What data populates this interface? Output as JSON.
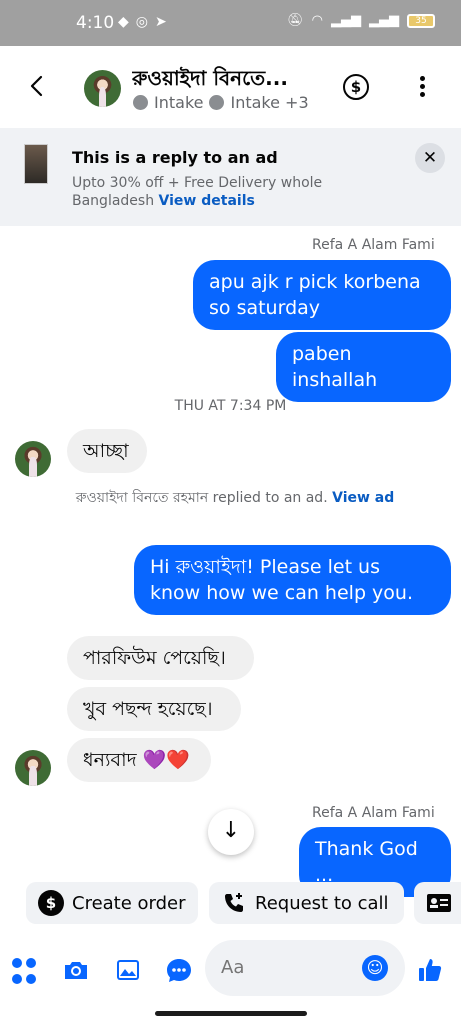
{
  "status_bar": {
    "time": "4:10",
    "battery": "35"
  },
  "header": {
    "title": "রুওয়াইদা বিনতে...",
    "subtitle_items": [
      "Intake",
      "Intake +3"
    ]
  },
  "ad_banner": {
    "title": "This is a reply to an ad",
    "body": "Upto 30% off + Free Delivery whole Bangladesh",
    "link": "View details",
    "close_glyph": "✕"
  },
  "messages": [
    {
      "type": "sender",
      "text": "Refa A Alam Fami"
    },
    {
      "type": "out",
      "text": "apu ajk r pick korbena so saturday"
    },
    {
      "type": "out",
      "text": "paben inshallah"
    },
    {
      "type": "timestamp",
      "text": "THU AT 7:34 PM"
    },
    {
      "type": "in",
      "text": "আচ্ছা"
    },
    {
      "type": "system",
      "text": "রুওয়াইদা বিনতে রহমান replied to an ad.",
      "link": "View ad"
    },
    {
      "type": "out",
      "text": "Hi রুওয়াইদা! Please let us know how we can help you."
    },
    {
      "type": "in",
      "text": "পারফিউম পেয়েছি।"
    },
    {
      "type": "in",
      "text": "খুব পছন্দ হয়েছে।"
    },
    {
      "type": "in",
      "text": "ধন্যবাদ 💜❤️"
    },
    {
      "type": "sender",
      "text": "Refa A Alam Fami"
    },
    {
      "type": "out",
      "text": "Thank God ..."
    }
  ],
  "quick_actions": {
    "create_order": "Create order",
    "request_call": "Request to call"
  },
  "composer": {
    "placeholder": "Aa"
  },
  "colors": {
    "accent": "#0866ff",
    "incoming": "#f0f0f0",
    "banner": "#f0f2f5"
  }
}
